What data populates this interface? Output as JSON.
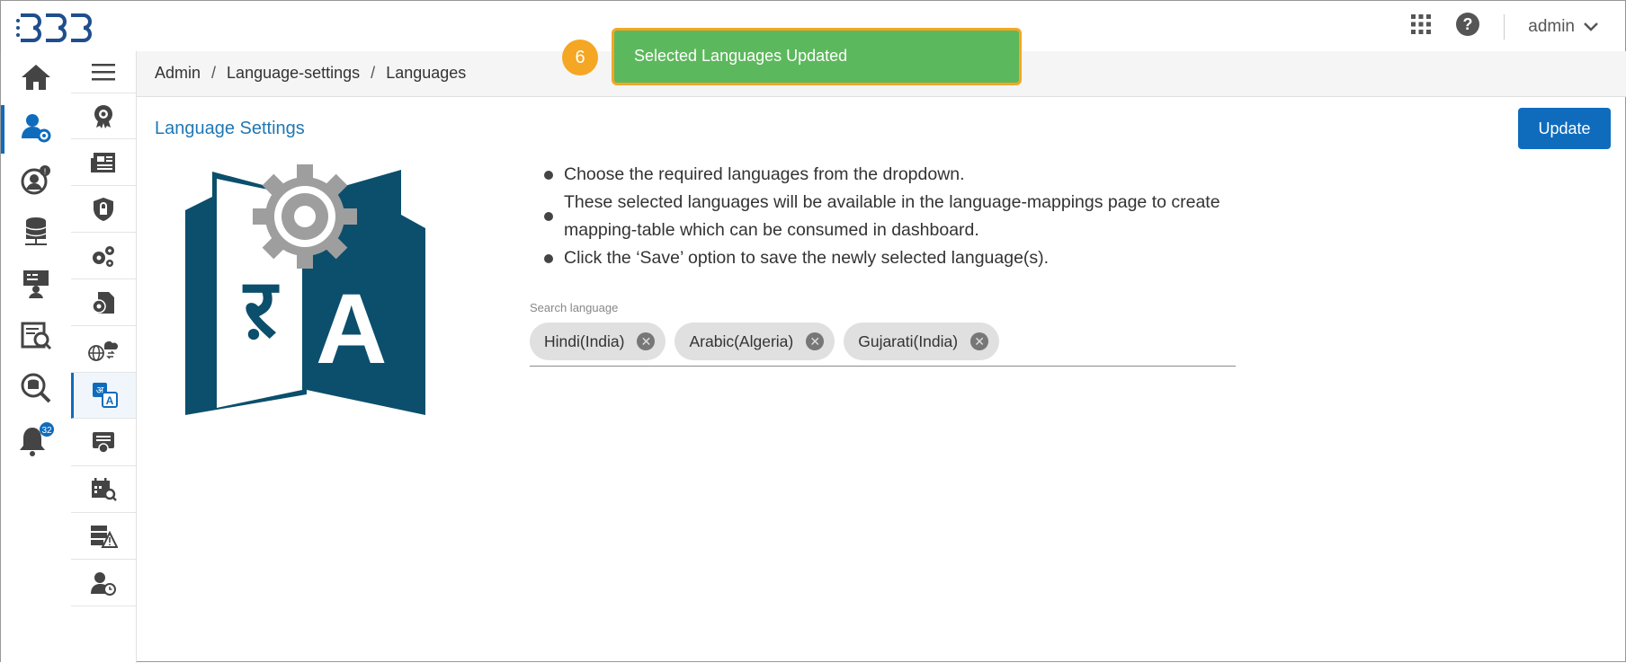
{
  "header": {
    "logo": "BDB",
    "user": "admin",
    "icons": [
      "apps-grid-icon",
      "help-icon",
      "chevron-down-icon"
    ]
  },
  "rail": {
    "items": [
      {
        "name": "home-icon"
      },
      {
        "name": "user-settings-icon",
        "active": true
      },
      {
        "name": "user-info-icon"
      },
      {
        "name": "database-icon"
      },
      {
        "name": "presentation-icon"
      },
      {
        "name": "data-search-icon"
      },
      {
        "name": "search-db-icon"
      },
      {
        "name": "notification-bell-icon",
        "badge": "32"
      }
    ]
  },
  "subnav": {
    "items": [
      {
        "name": "certificate-icon"
      },
      {
        "name": "newspaper-icon"
      },
      {
        "name": "shield-lock-icon"
      },
      {
        "name": "gears-icon"
      },
      {
        "name": "file-settings-icon"
      },
      {
        "name": "globe-cloud-icon"
      },
      {
        "name": "language-icon",
        "active": true
      },
      {
        "name": "license-icon"
      },
      {
        "name": "calendar-search-icon"
      },
      {
        "name": "server-warning-icon"
      },
      {
        "name": "user-history-icon"
      }
    ]
  },
  "breadcrumb": [
    "Admin",
    "Language-settings",
    "Languages"
  ],
  "toast": {
    "message": "Selected Languages Updated",
    "step": "6"
  },
  "page": {
    "title": "Language Settings",
    "update_label": "Update",
    "bullets": [
      "Choose the required languages from the dropdown.",
      "These selected languages will be available in the language-mappings page to create mapping-table which can be consumed in dashboard.",
      "Click the ‘Save’ option to save the newly selected language(s)."
    ],
    "search_label": "Search language",
    "chips": [
      "Hindi(India)",
      "Arabic(Algeria)",
      "Gujarati(India)"
    ]
  },
  "colors": {
    "accent": "#0f6cbd",
    "toast": "#5cb85c",
    "highlight": "#f5a623",
    "hero": "#0b4f6c"
  }
}
